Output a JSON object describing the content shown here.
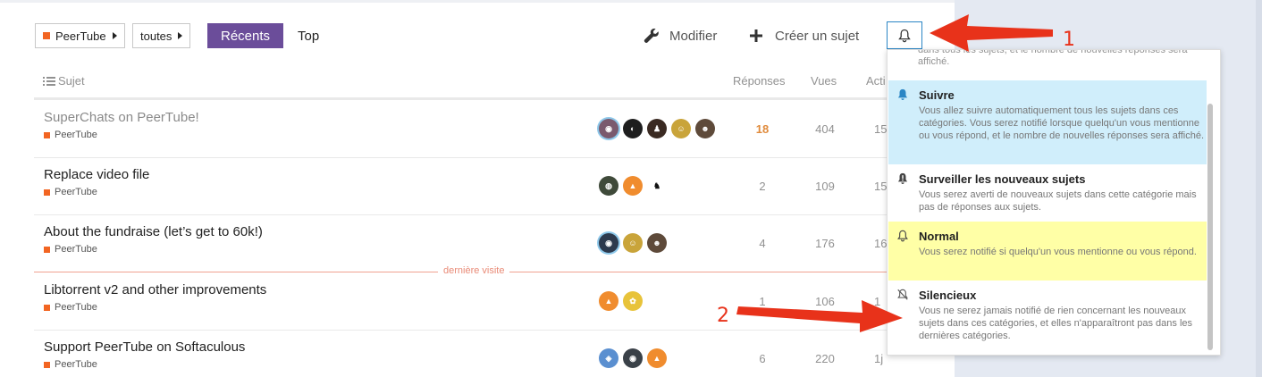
{
  "nav": {
    "category": "PeerTube",
    "filter": "toutes",
    "recent": "Récents",
    "top": "Top",
    "edit": "Modifier",
    "create": "Créer un sujet"
  },
  "table": {
    "head": {
      "topic": "Sujet",
      "replies": "Réponses",
      "views": "Vues",
      "activity": "Acti"
    },
    "rows": [
      {
        "title": "SuperChats on PeerTube!",
        "category": "PeerTube",
        "replies": "18",
        "views": "404",
        "activity": "15"
      },
      {
        "title": "Replace video file",
        "category": "PeerTube",
        "replies": "2",
        "views": "109",
        "activity": "15"
      },
      {
        "title": "About the fundraise (let’s get to 60k!)",
        "category": "PeerTube",
        "replies": "4",
        "views": "176",
        "activity": "16"
      },
      {
        "title": "Libtorrent v2 and other improvements",
        "category": "PeerTube",
        "replies": "1",
        "views": "106",
        "activity": "1"
      },
      {
        "title": "Support PeerTube on Softaculous",
        "category": "PeerTube",
        "replies": "6",
        "views": "220",
        "activity": "1j"
      }
    ],
    "last_visit": "dernière visite"
  },
  "dropdown": {
    "top_text": "dans tous les sujets, et le nombre de nouvelles réponses sera affiché.",
    "options": [
      {
        "name": "Suivre",
        "desc": "Vous allez suivre automatiquement tous les sujets dans ces catégories. Vous serez notifié lorsque quelqu'un vous mentionne ou vous répond, et le nombre de nouvelles réponses sera affiché."
      },
      {
        "name": "Surveiller les nouveaux sujets",
        "desc": "Vous serez averti de nouveaux sujets dans cette catégorie mais pas de réponses aux sujets."
      },
      {
        "name": "Normal",
        "desc": "Vous serez notifié si quelqu'un vous mentionne ou vous répond."
      },
      {
        "name": "Silencieux",
        "desc": "Vous ne serez jamais notifié de rien concernant les nouveaux sujets dans ces catégories, et elles n'apparaîtront pas dans les dernières catégories."
      }
    ]
  },
  "annotations": {
    "label_1": "1",
    "label_2": "2"
  },
  "colors": {
    "accent": "#6b4d9a",
    "category": "#f26522",
    "arrow": "#e8321a",
    "highlight_follow": "#d0eefb",
    "highlight_normal": "#ffffa6"
  }
}
